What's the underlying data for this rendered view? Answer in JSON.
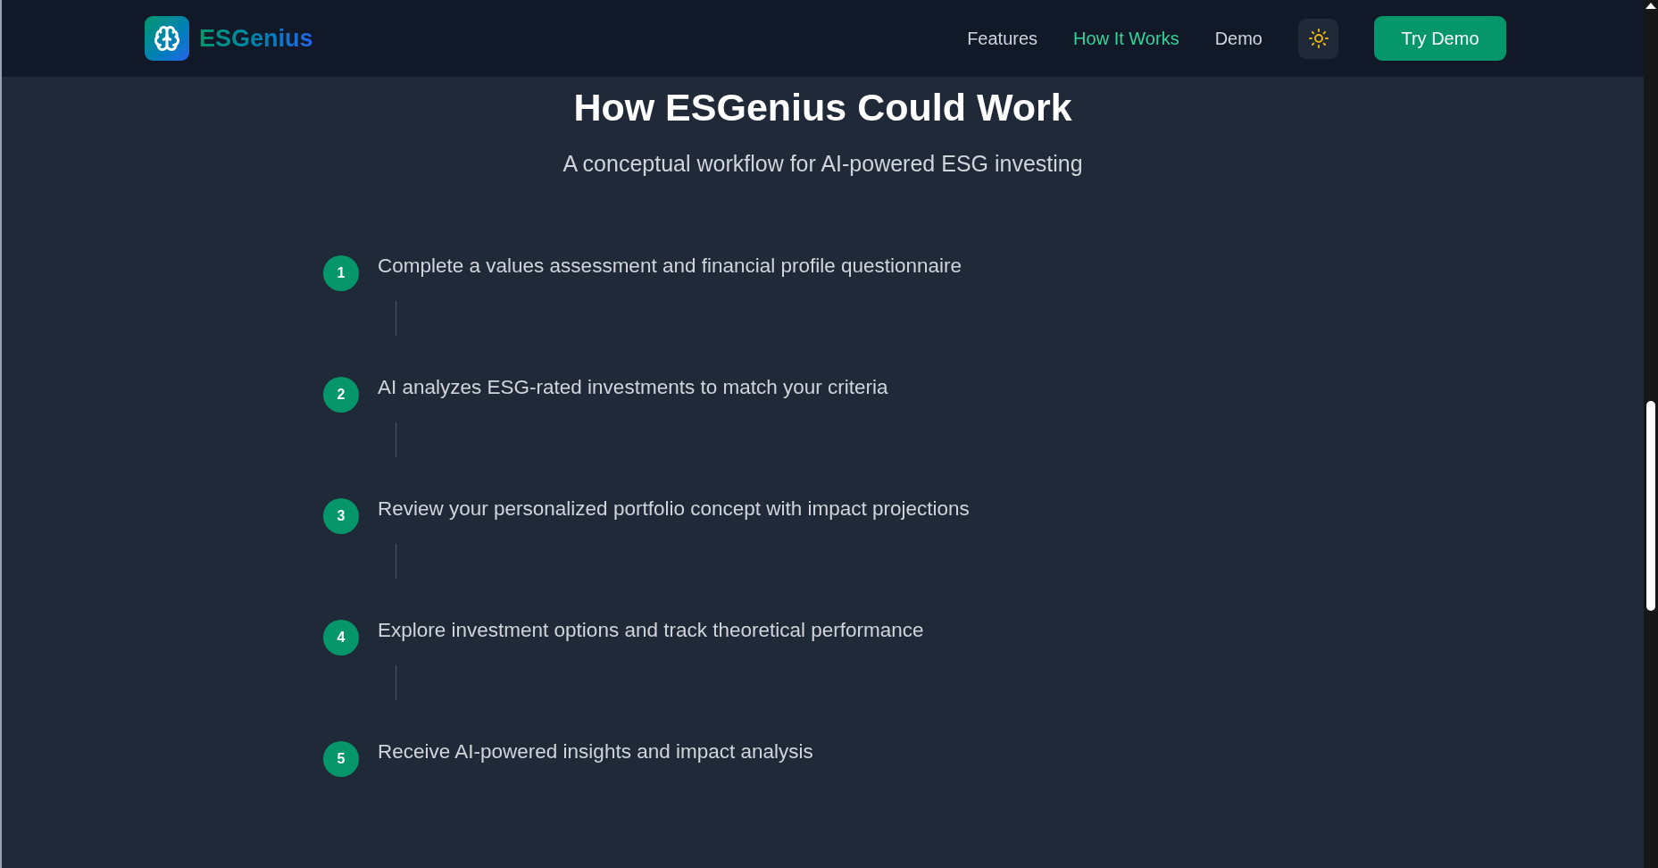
{
  "header": {
    "brand": "ESGenius",
    "nav": [
      {
        "label": "Features",
        "selected": false
      },
      {
        "label": "How It Works",
        "selected": true
      },
      {
        "label": "Demo",
        "selected": false
      }
    ],
    "cta": "Try Demo"
  },
  "section": {
    "title": "How ESGenius Could Work",
    "subtitle": "A conceptual workflow for AI-powered ESG investing",
    "steps": [
      {
        "number": "1",
        "text": "Complete a values assessment and financial profile questionnaire"
      },
      {
        "number": "2",
        "text": "AI analyzes ESG-rated investments to match your criteria"
      },
      {
        "number": "3",
        "text": "Review your personalized portfolio concept with impact projections"
      },
      {
        "number": "4",
        "text": "Explore investment options and track theoretical performance"
      },
      {
        "number": "5",
        "text": "Receive AI-powered insights and impact analysis"
      }
    ]
  }
}
